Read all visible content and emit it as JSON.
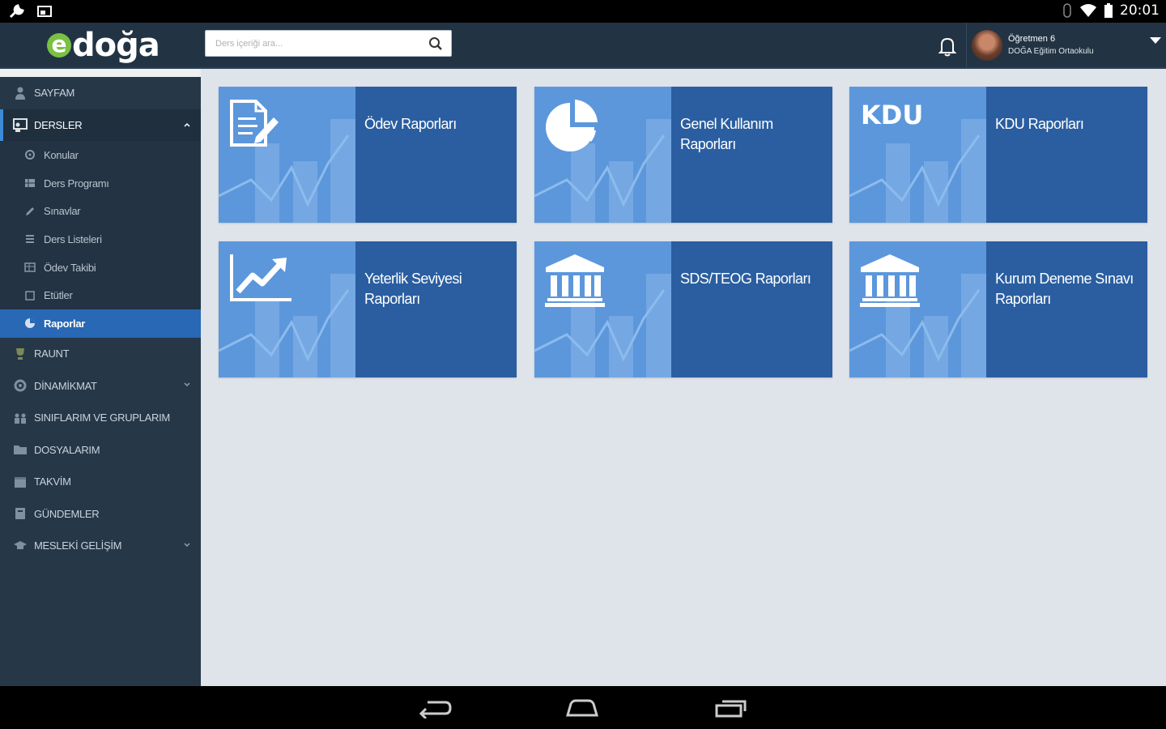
{
  "statusbar": {
    "time": "20:01"
  },
  "app": {
    "logo_e": "e",
    "logo_text": "doğa"
  },
  "search": {
    "placeholder": "Ders içeriği ara..."
  },
  "user": {
    "name": "Öğretmen 6",
    "school": "DOĞA Eğitim Ortaokulu"
  },
  "sidebar": {
    "items": [
      {
        "label": "SAYFAM",
        "icon": "user-icon"
      },
      {
        "label": "DERSLER",
        "icon": "lessons-icon",
        "expanded": true
      },
      {
        "label": "RAUNT",
        "icon": "trophy-icon"
      },
      {
        "label": "DİNAMİKMAT",
        "icon": "gear-icon"
      },
      {
        "label": "SINIFLARIM VE GRUPLARIM",
        "icon": "group-icon"
      },
      {
        "label": "DOSYALARIM",
        "icon": "folder-icon"
      },
      {
        "label": "TAKVİM",
        "icon": "calendar-icon"
      },
      {
        "label": "GÜNDEMLER",
        "icon": "agenda-icon"
      },
      {
        "label": "MESLEKİ GELİŞİM",
        "icon": "graduation-icon"
      }
    ],
    "subitems": [
      {
        "label": "Konular",
        "icon": "gear-icon"
      },
      {
        "label": "Ders Programı",
        "icon": "grid-icon"
      },
      {
        "label": "Sınavlar",
        "icon": "pencil-icon"
      },
      {
        "label": "Ders Listeleri",
        "icon": "list-icon"
      },
      {
        "label": "Ödev Takibi",
        "icon": "table-icon"
      },
      {
        "label": "Etütler",
        "icon": "square-icon"
      },
      {
        "label": "Raporlar",
        "icon": "pie-icon",
        "active": true
      }
    ]
  },
  "cards": [
    {
      "title": "Ödev Raporları",
      "icon": "document-edit-icon"
    },
    {
      "title_line1": "Genel Kullanım",
      "title_line2": "Raporları",
      "icon": "pie-chart-icon"
    },
    {
      "title": "KDU Raporları",
      "badge": "KDU"
    },
    {
      "title_line1": "Yeterlik Seviyesi",
      "title_line2": "Raporları",
      "icon": "trend-chart-icon"
    },
    {
      "title": "SDS/TEOG Raporları",
      "icon": "institution-icon"
    },
    {
      "title_line1": "Kurum Deneme Sınavı",
      "title_line2": "Raporları",
      "icon": "institution-icon"
    }
  ]
}
